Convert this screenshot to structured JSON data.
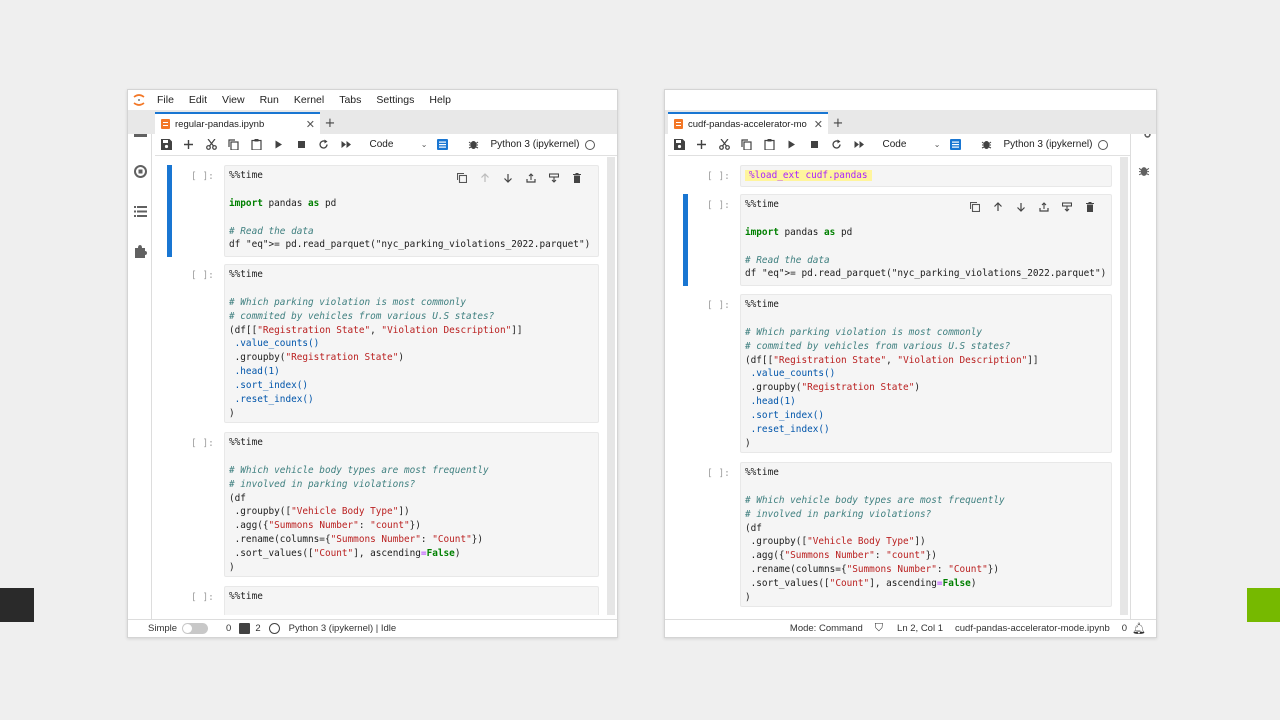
{
  "colors": {
    "accent": "#1976d2",
    "desktop": "#efefef",
    "edge_left": "#2a2a2a",
    "edge_right": "#76b900",
    "magic_highlight": "#fff59d"
  },
  "left": {
    "menu": [
      "File",
      "Edit",
      "View",
      "Run",
      "Kernel",
      "Tabs",
      "Settings",
      "Help"
    ],
    "tab": {
      "label": "regular-pandas.ipynb"
    },
    "toolbar": {
      "cell_type": "Code",
      "kernel": "Python 3 (ipykernel)"
    },
    "status": {
      "mode_label": "Simple",
      "count1": "0",
      "count2": "2",
      "kernel_status": "Python 3 (ipykernel) | Idle"
    },
    "cells": [
      {
        "prompt": "[ ]:",
        "lines": [
          "%%time",
          "",
          "import pandas as pd",
          "",
          "# Read the data",
          "df = pd.read_parquet(\"nyc_parking_violations_2022.parquet\")"
        ]
      },
      {
        "prompt": "[ ]:",
        "lines": [
          "%%time",
          "",
          "# Which parking violation is most commonly",
          "# commited by vehicles from various U.S states?",
          "(df[[\"Registration State\", \"Violation Description\"]]",
          " .value_counts()",
          " .groupby(\"Registration State\")",
          " .head(1)",
          " .sort_index()",
          " .reset_index()",
          ")"
        ]
      },
      {
        "prompt": "[ ]:",
        "lines": [
          "%%time",
          "",
          "# Which vehicle body types are most frequently",
          "# involved in parking violations?",
          "(df",
          " .groupby([\"Vehicle Body Type\"])",
          " .agg({\"Summons Number\": \"count\"})",
          " .rename(columns={\"Summons Number\": \"Count\"})",
          " .sort_values([\"Count\"], ascending=False)",
          ")"
        ]
      },
      {
        "prompt": "[ ]:",
        "lines": [
          "%%time"
        ]
      }
    ]
  },
  "right": {
    "tab": {
      "label": "cudf-pandas-accelerator-mo"
    },
    "toolbar": {
      "cell_type": "Code",
      "kernel": "Python 3 (ipykernel)"
    },
    "status": {
      "mode": "Mode: Command",
      "position": "Ln 2, Col 1",
      "filename": "cudf-pandas-accelerator-mode.ipynb",
      "count": "0"
    },
    "cells": [
      {
        "prompt": "[ ]:",
        "lines": [
          "%load_ext cudf.pandas"
        ]
      },
      {
        "prompt": "[ ]:",
        "lines": [
          "%%time",
          "",
          "import pandas as pd",
          "",
          "# Read the data",
          "df = pd.read_parquet(\"nyc_parking_violations_2022.parquet\")"
        ]
      },
      {
        "prompt": "[ ]:",
        "lines": [
          "%%time",
          "",
          "# Which parking violation is most commonly",
          "# commited by vehicles from various U.S states?",
          "(df[[\"Registration State\", \"Violation Description\"]]",
          " .value_counts()",
          " .groupby(\"Registration State\")",
          " .head(1)",
          " .sort_index()",
          " .reset_index()",
          ")"
        ]
      },
      {
        "prompt": "[ ]:",
        "lines": [
          "%%time",
          "",
          "# Which vehicle body types are most frequently",
          "# involved in parking violations?",
          "(df",
          " .groupby([\"Vehicle Body Type\"])",
          " .agg({\"Summons Number\": \"count\"})",
          " .rename(columns={\"Summons Number\": \"Count\"})",
          " .sort_values([\"Count\"], ascending=False)",
          ")"
        ]
      }
    ]
  }
}
